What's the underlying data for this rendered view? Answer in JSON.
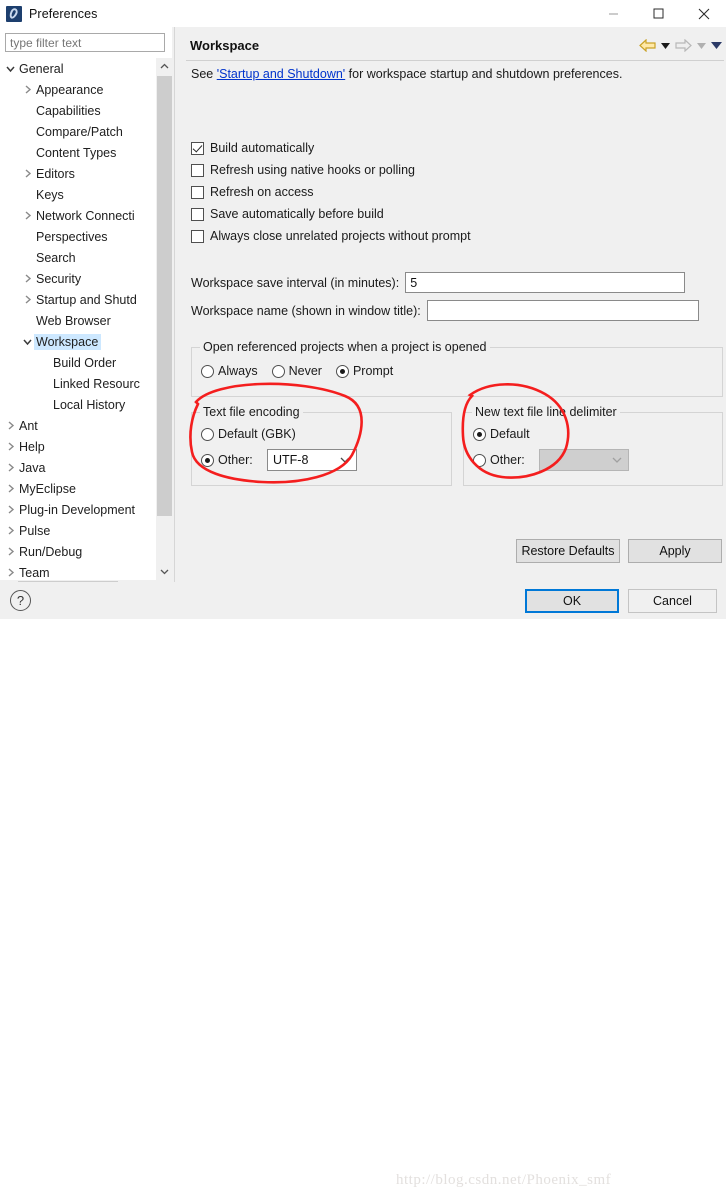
{
  "window": {
    "title": "Preferences",
    "icon": "eclipse-preferences-icon",
    "controls": {
      "minimize": "minimize-icon",
      "maximize": "maximize-icon",
      "close": "close-icon"
    }
  },
  "sidebar": {
    "filter": {
      "placeholder": "type filter text",
      "value": ""
    },
    "items": [
      {
        "label": "General",
        "indent": 0,
        "twisty": "expanded",
        "selected": false
      },
      {
        "label": "Appearance",
        "indent": 1,
        "twisty": "collapsed",
        "selected": false
      },
      {
        "label": "Capabilities",
        "indent": 1,
        "twisty": "none",
        "selected": false
      },
      {
        "label": "Compare/Patch",
        "indent": 1,
        "twisty": "none",
        "selected": false
      },
      {
        "label": "Content Types",
        "indent": 1,
        "twisty": "none",
        "selected": false
      },
      {
        "label": "Editors",
        "indent": 1,
        "twisty": "collapsed",
        "selected": false
      },
      {
        "label": "Keys",
        "indent": 1,
        "twisty": "none",
        "selected": false
      },
      {
        "label": "Network Connecti",
        "indent": 1,
        "twisty": "collapsed",
        "selected": false
      },
      {
        "label": "Perspectives",
        "indent": 1,
        "twisty": "none",
        "selected": false
      },
      {
        "label": "Search",
        "indent": 1,
        "twisty": "none",
        "selected": false
      },
      {
        "label": "Security",
        "indent": 1,
        "twisty": "collapsed",
        "selected": false
      },
      {
        "label": "Startup and Shutd",
        "indent": 1,
        "twisty": "collapsed",
        "selected": false
      },
      {
        "label": "Web Browser",
        "indent": 1,
        "twisty": "none",
        "selected": false
      },
      {
        "label": "Workspace",
        "indent": 1,
        "twisty": "expanded",
        "selected": true
      },
      {
        "label": "Build Order",
        "indent": 2,
        "twisty": "none",
        "selected": false
      },
      {
        "label": "Linked Resourc",
        "indent": 2,
        "twisty": "none",
        "selected": false
      },
      {
        "label": "Local History",
        "indent": 2,
        "twisty": "none",
        "selected": false
      },
      {
        "label": "Ant",
        "indent": 0,
        "twisty": "collapsed",
        "selected": false
      },
      {
        "label": "Help",
        "indent": 0,
        "twisty": "collapsed",
        "selected": false
      },
      {
        "label": "Java",
        "indent": 0,
        "twisty": "collapsed",
        "selected": false
      },
      {
        "label": "MyEclipse",
        "indent": 0,
        "twisty": "collapsed",
        "selected": false
      },
      {
        "label": "Plug-in Development",
        "indent": 0,
        "twisty": "collapsed",
        "selected": false
      },
      {
        "label": "Pulse",
        "indent": 0,
        "twisty": "collapsed",
        "selected": false
      },
      {
        "label": "Run/Debug",
        "indent": 0,
        "twisty": "collapsed",
        "selected": false
      },
      {
        "label": "Team",
        "indent": 0,
        "twisty": "collapsed",
        "selected": false
      }
    ]
  },
  "page": {
    "title": "Workspace",
    "nav": {
      "back": "back-arrow-icon",
      "back_menu": "back-dropdown-icon",
      "forward": "forward-arrow-icon",
      "forward_menu": "forward-dropdown-icon",
      "menu": "view-menu-icon"
    },
    "description_prefix": "See ",
    "description_link": "'Startup and Shutdown'",
    "description_suffix": " for workspace startup and shutdown preferences.",
    "checkboxes": [
      {
        "label": "Build automatically",
        "checked": true
      },
      {
        "label": "Refresh using native hooks or polling",
        "checked": false
      },
      {
        "label": "Refresh on access",
        "checked": false
      },
      {
        "label": "Save automatically before build",
        "checked": false
      },
      {
        "label": "Always close unrelated projects without prompt",
        "checked": false
      }
    ],
    "fields": [
      {
        "label": "Workspace save interval (in minutes):",
        "value": "5"
      },
      {
        "label": "Workspace name (shown in window title):",
        "value": ""
      }
    ],
    "open_referenced": {
      "title": "Open referenced projects when a project is opened",
      "options": [
        {
          "label": "Always",
          "selected": false
        },
        {
          "label": "Never",
          "selected": false
        },
        {
          "label": "Prompt",
          "selected": true
        }
      ]
    },
    "text_file_encoding": {
      "title": "Text file encoding",
      "default_label": "Default (GBK)",
      "default_selected": false,
      "other_label": "Other:",
      "other_selected": true,
      "combo_value": "UTF-8",
      "combo_disabled": false
    },
    "line_delimiter": {
      "title": "New text file line delimiter",
      "default_label": "Default",
      "default_selected": true,
      "other_label": "Other:",
      "other_selected": false,
      "combo_value": "",
      "combo_disabled": true
    },
    "buttons": {
      "restore_defaults": "Restore Defaults",
      "apply": "Apply"
    }
  },
  "footer": {
    "help": "?",
    "ok": "OK",
    "cancel": "Cancel",
    "watermark": "http://blog.csdn.net/Phoenix_smf"
  },
  "colors": {
    "selection": "#cde8ff",
    "link": "#0033cc",
    "focus": "#0078d7",
    "annotation": "#f41e1e",
    "panel": "#f0f0f0"
  }
}
